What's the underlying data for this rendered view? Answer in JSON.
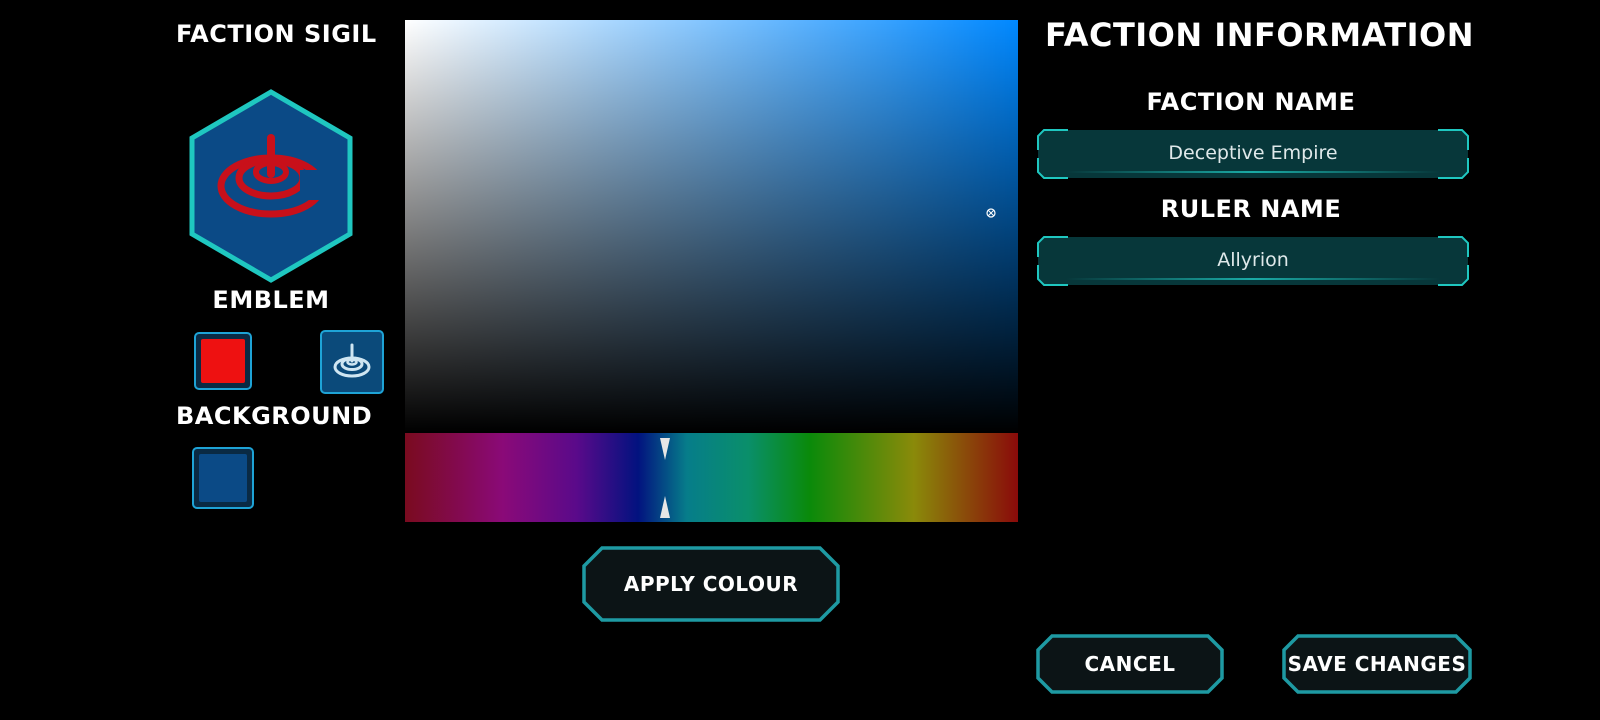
{
  "sigil": {
    "title": "FACTION SIGIL",
    "emblem_title": "EMBLEM",
    "background_title": "BACKGROUND",
    "emblem_color": "#ee1111",
    "emblem_icon": "ripple-drop-icon",
    "background_color": "#0b4a86",
    "hex_border_color": "#1fc7c0"
  },
  "color_picker": {
    "base_hue_color": "#0088ff"
  },
  "buttons": {
    "apply": "APPLY COLOUR",
    "cancel": "CANCEL",
    "save": "SAVE CHANGES"
  },
  "info": {
    "title": "FACTION INFORMATION",
    "faction_name_label": "FACTION NAME",
    "faction_name_value": "Deceptive Empire",
    "ruler_name_label": "RULER NAME",
    "ruler_name_value": "Allyrion"
  },
  "theme": {
    "accent": "#1e9aa3",
    "field_bg": "#07373a"
  }
}
